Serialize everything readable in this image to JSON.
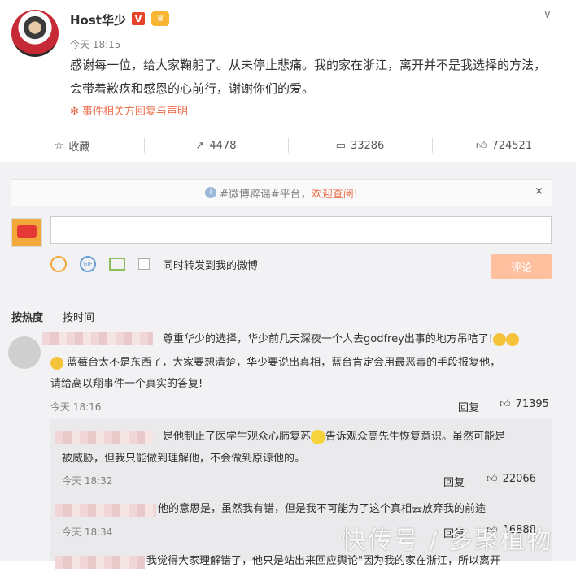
{
  "post": {
    "author": "Host华少",
    "v_badge": "V",
    "time": "今天 18:15",
    "content": "感谢每一位，给大家鞠躬了。从未停止悲痛。我的家在浙江，离开并不是我选择的方法，会带着歉疚和感恩的心前行，谢谢你们的爱。",
    "related_link": "事件相关方回复与声明",
    "more_icon": "chevron-down-icon"
  },
  "actions": {
    "favorite": "收藏",
    "forward_count": "4478",
    "comment_count": "33286",
    "like_count": "724521"
  },
  "notice": {
    "text": "#微博辟谣#平台，",
    "link": "欢迎查阅!",
    "close": "×"
  },
  "composer": {
    "input_value": "",
    "forward_option": "同时转发到我的微博",
    "submit_label": "评论"
  },
  "sort": {
    "by_hot": "按热度",
    "by_time": "按时间"
  },
  "comments": [
    {
      "text": "尊重华少的选择，华少前几天深夜一个人去godfrey出事的地方吊唁了!",
      "text2": "蓝莓台太不是东西了，大家要想清楚，华少要说出真相，蓝台肯定会用最恶毒的手段报复他，",
      "text3": "请给高以翔事件一个真实的答复!",
      "time": "今天 18:16",
      "reply": "回复",
      "likes": "71395"
    }
  ],
  "replies": [
    {
      "text": "是他制止了医学生观众心肺复苏",
      "text_after": "告诉观众高先生恢复意识。虽然可能是",
      "text2": "被威胁，但我只能做到理解他，不会做到原谅他的。",
      "time": "今天 18:32",
      "reply": "回复",
      "likes": "22066"
    },
    {
      "text": "他的意思是，虽然我有错，但是我不可能为了这个真相去放弃我的前途",
      "time": "今天 18:34",
      "reply": "回复",
      "likes": "16888"
    },
    {
      "text": "我觉得大家理解错了，他只是站出来回应舆论\"因为我的家在浙江，所以离开"
    }
  ],
  "watermark": "快传号 / 多聚植物"
}
